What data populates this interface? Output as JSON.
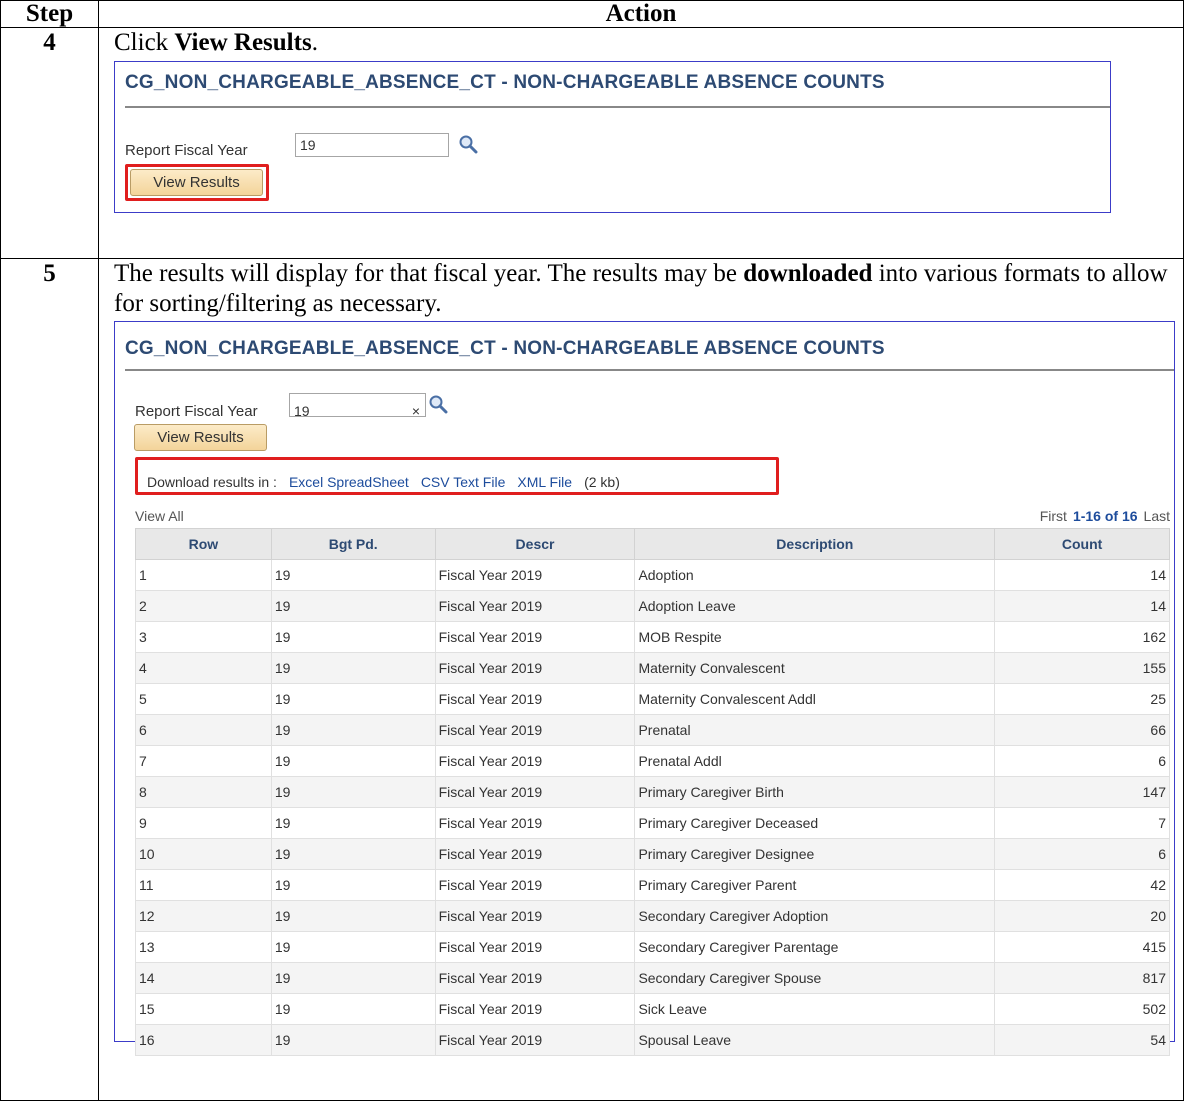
{
  "header": {
    "step": "Step",
    "action": "Action"
  },
  "step4": {
    "number": "4",
    "instruction_prefix": "Click ",
    "instruction_bold": "View Results",
    "instruction_suffix": ".",
    "screen": {
      "title": "CG_NON_CHARGEABLE_ABSENCE_CT - NON-CHARGEABLE ABSENCE COUNTS",
      "fy_label": "Report Fiscal Year",
      "fy_value": "19",
      "button_label": "View Results"
    }
  },
  "step5": {
    "number": "5",
    "instruction_1": "The results will display for that fiscal year. The results may be ",
    "instruction_bold": "downloaded",
    "instruction_2": " into various formats to allow for sorting/filtering as necessary.",
    "screen": {
      "title": "CG_NON_CHARGEABLE_ABSENCE_CT - NON-CHARGEABLE ABSENCE COUNTS",
      "fy_label": "Report Fiscal Year",
      "fy_value": "19",
      "clear_glyph": "×",
      "button_label": "View Results",
      "download_label": "Download results in :",
      "excel_link": "Excel SpreadSheet",
      "csv_link": "CSV Text File",
      "xml_link": "XML File",
      "size": "(2 kb)",
      "view_all": "View All",
      "pager_first": "First",
      "pager_range": "1-16 of 16",
      "pager_last": "Last",
      "columns": [
        "Row",
        "Bgt Pd.",
        "Descr",
        "Description",
        "Count"
      ],
      "rows": [
        {
          "row": "1",
          "bgt": "19",
          "descr": "Fiscal Year 2019",
          "description": "Adoption",
          "count": "14"
        },
        {
          "row": "2",
          "bgt": "19",
          "descr": "Fiscal Year 2019",
          "description": "Adoption Leave",
          "count": "14"
        },
        {
          "row": "3",
          "bgt": "19",
          "descr": "Fiscal Year 2019",
          "description": "MOB Respite",
          "count": "162"
        },
        {
          "row": "4",
          "bgt": "19",
          "descr": "Fiscal Year 2019",
          "description": "Maternity Convalescent",
          "count": "155"
        },
        {
          "row": "5",
          "bgt": "19",
          "descr": "Fiscal Year 2019",
          "description": "Maternity Convalescent Addl",
          "count": "25"
        },
        {
          "row": "6",
          "bgt": "19",
          "descr": "Fiscal Year 2019",
          "description": "Prenatal",
          "count": "66"
        },
        {
          "row": "7",
          "bgt": "19",
          "descr": "Fiscal Year 2019",
          "description": "Prenatal Addl",
          "count": "6"
        },
        {
          "row": "8",
          "bgt": "19",
          "descr": "Fiscal Year 2019",
          "description": "Primary Caregiver Birth",
          "count": "147"
        },
        {
          "row": "9",
          "bgt": "19",
          "descr": "Fiscal Year 2019",
          "description": "Primary Caregiver Deceased",
          "count": "7"
        },
        {
          "row": "10",
          "bgt": "19",
          "descr": "Fiscal Year 2019",
          "description": "Primary Caregiver Designee",
          "count": "6"
        },
        {
          "row": "11",
          "bgt": "19",
          "descr": "Fiscal Year 2019",
          "description": "Primary Caregiver Parent",
          "count": "42"
        },
        {
          "row": "12",
          "bgt": "19",
          "descr": "Fiscal Year 2019",
          "description": "Secondary Caregiver Adoption",
          "count": "20"
        },
        {
          "row": "13",
          "bgt": "19",
          "descr": "Fiscal Year 2019",
          "description": "Secondary Caregiver Parentage",
          "count": "415"
        },
        {
          "row": "14",
          "bgt": "19",
          "descr": "Fiscal Year 2019",
          "description": "Secondary Caregiver Spouse",
          "count": "817"
        },
        {
          "row": "15",
          "bgt": "19",
          "descr": "Fiscal Year 2019",
          "description": "Sick Leave",
          "count": "502"
        },
        {
          "row": "16",
          "bgt": "19",
          "descr": "Fiscal Year 2019",
          "description": "Spousal Leave",
          "count": "54"
        }
      ]
    }
  },
  "icons": {
    "lookup": "magnifier-lookup-icon"
  },
  "colors": {
    "highlight": "#e01e1e",
    "title": "#2d4a73",
    "link": "#1d4c9c",
    "frame": "#3c3cc8"
  }
}
